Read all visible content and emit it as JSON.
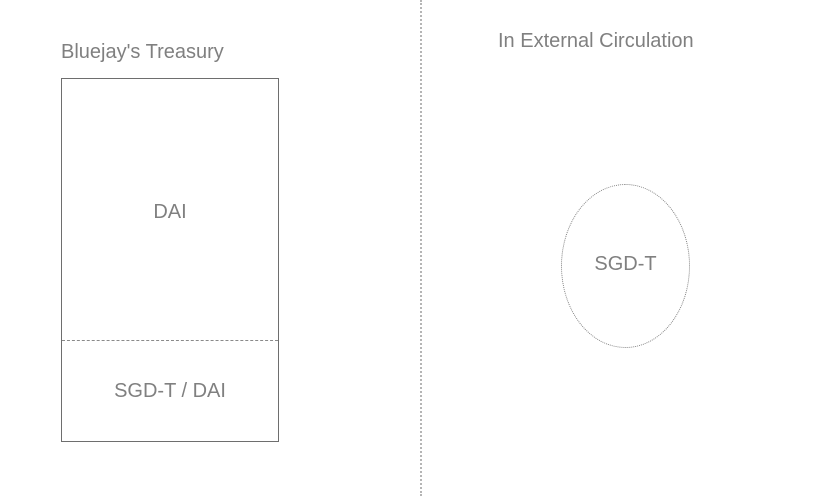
{
  "treasury": {
    "title": "Bluejay's Treasury",
    "upper_section": "DAI",
    "lower_section": "SGD-T / DAI"
  },
  "circulation": {
    "title": "In External Circulation",
    "token": "SGD-T"
  }
}
